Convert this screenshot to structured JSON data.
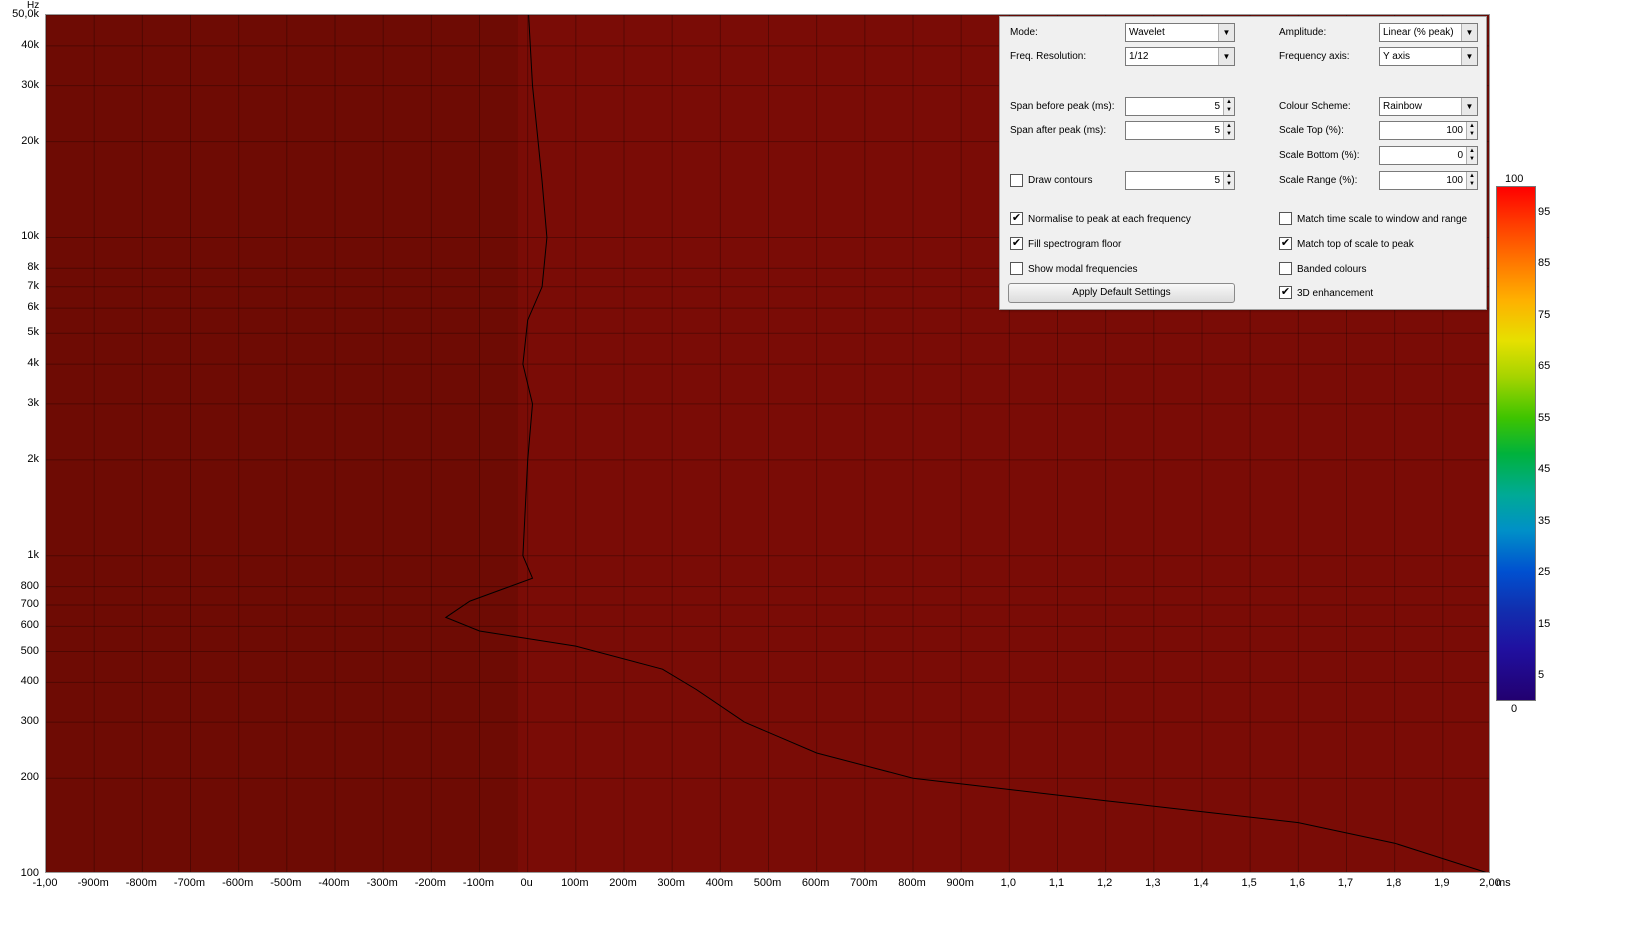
{
  "chart_data": {
    "type": "heatmap",
    "title": "",
    "xlabel": "",
    "ylabel": "",
    "x_unit": "ms",
    "y_unit": "Hz",
    "xlim": [
      -1.0,
      2.0
    ],
    "ylim": [
      100,
      50000
    ],
    "y_scale": "log",
    "grid": true,
    "x_ticks": [
      "-1,00",
      "-900m",
      "-800m",
      "-700m",
      "-600m",
      "-500m",
      "-400m",
      "-300m",
      "-200m",
      "-100m",
      "0u",
      "100m",
      "200m",
      "300m",
      "400m",
      "500m",
      "600m",
      "700m",
      "800m",
      "900m",
      "1,0",
      "1,1",
      "1,2",
      "1,3",
      "1,4",
      "1,5",
      "1,6",
      "1,7",
      "1,8",
      "1,9",
      "2,00"
    ],
    "y_ticks": [
      {
        "label": "50,0k",
        "hz": 50000
      },
      {
        "label": "40k",
        "hz": 40000
      },
      {
        "label": "30k",
        "hz": 30000
      },
      {
        "label": "20k",
        "hz": 20000
      },
      {
        "label": "10k",
        "hz": 10000
      },
      {
        "label": "8k",
        "hz": 8000
      },
      {
        "label": "7k",
        "hz": 7000
      },
      {
        "label": "6k",
        "hz": 6000
      },
      {
        "label": "5k",
        "hz": 5000
      },
      {
        "label": "4k",
        "hz": 4000
      },
      {
        "label": "3k",
        "hz": 3000
      },
      {
        "label": "2k",
        "hz": 2000
      },
      {
        "label": "1k",
        "hz": 1000
      },
      {
        "label": "800",
        "hz": 800
      },
      {
        "label": "700",
        "hz": 700
      },
      {
        "label": "600",
        "hz": 600
      },
      {
        "label": "500",
        "hz": 500
      },
      {
        "label": "400",
        "hz": 400
      },
      {
        "label": "300",
        "hz": 300
      },
      {
        "label": "200",
        "hz": 200
      },
      {
        "label": "100",
        "hz": 100
      }
    ],
    "peak_curve": [
      {
        "t": 0.002,
        "hz": 50000
      },
      {
        "t": 0.01,
        "hz": 30000
      },
      {
        "t": 0.03,
        "hz": 15000
      },
      {
        "t": 0.04,
        "hz": 10000
      },
      {
        "t": 0.03,
        "hz": 7000
      },
      {
        "t": 0.0,
        "hz": 5500
      },
      {
        "t": -0.01,
        "hz": 4000
      },
      {
        "t": 0.01,
        "hz": 3000
      },
      {
        "t": 0.0,
        "hz": 2000
      },
      {
        "t": -0.01,
        "hz": 1000
      },
      {
        "t": 0.01,
        "hz": 850
      },
      {
        "t": -0.12,
        "hz": 720
      },
      {
        "t": -0.17,
        "hz": 640
      },
      {
        "t": -0.1,
        "hz": 580
      },
      {
        "t": 0.1,
        "hz": 520
      },
      {
        "t": 0.28,
        "hz": 440
      },
      {
        "t": 0.35,
        "hz": 380
      },
      {
        "t": 0.45,
        "hz": 300
      },
      {
        "t": 0.6,
        "hz": 240
      },
      {
        "t": 0.8,
        "hz": 200
      },
      {
        "t": 1.2,
        "hz": 170
      },
      {
        "t": 1.6,
        "hz": 145
      },
      {
        "t": 1.8,
        "hz": 125
      },
      {
        "t": 2.0,
        "hz": 100
      }
    ],
    "colour_scale": {
      "top_label": "100",
      "bottom_label": "0",
      "ticks": [
        "95",
        "85",
        "75",
        "65",
        "55",
        "45",
        "35",
        "25",
        "15",
        "5"
      ],
      "colors": [
        "#ff0000",
        "#ff7a00",
        "#e6e000",
        "#3ec400",
        "#00aa96",
        "#0050d0",
        "#220070"
      ]
    }
  },
  "panel": {
    "mode_label": "Mode:",
    "mode_value": "Wavelet",
    "freqres_label": "Freq. Resolution:",
    "freqres_value": "1/12",
    "amplitude_label": "Amplitude:",
    "amplitude_value": "Linear (% peak)",
    "freqaxis_label": "Frequency axis:",
    "freqaxis_value": "Y axis",
    "span_before_label": "Span before peak (ms):",
    "span_before_value": "5",
    "span_after_label": "Span after peak (ms):",
    "span_after_value": "5",
    "colour_scheme_label": "Colour Scheme:",
    "colour_scheme_value": "Rainbow",
    "scale_top_label": "Scale Top (%):",
    "scale_top_value": "100",
    "scale_bottom_label": "Scale Bottom (%):",
    "scale_bottom_value": "0",
    "scale_range_label": "Scale Range (%):",
    "scale_range_value": "100",
    "draw_contours_label": "Draw contours",
    "draw_contours_value": "5",
    "draw_contours_checked": false,
    "normalise_label": "Normalise to peak at each frequency",
    "normalise_checked": true,
    "fill_floor_label": "Fill spectrogram floor",
    "fill_floor_checked": true,
    "modal_label": "Show modal frequencies",
    "modal_checked": false,
    "match_time_label": "Match time scale to window and range",
    "match_time_checked": false,
    "match_top_label": "Match top of scale to peak",
    "match_top_checked": true,
    "banded_label": "Banded colours",
    "banded_checked": false,
    "enh3d_label": "3D enhancement",
    "enh3d_checked": true,
    "apply_label": "Apply Default Settings"
  }
}
